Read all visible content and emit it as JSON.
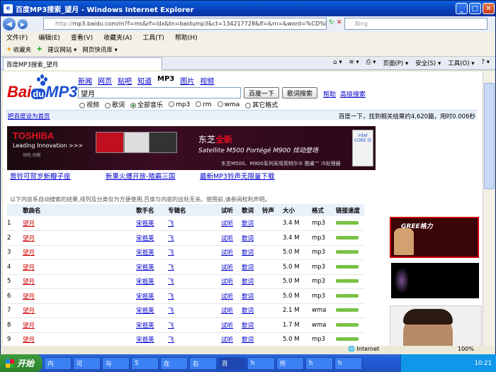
{
  "window": {
    "title": "百度MP3搜索_望月 - Windows Internet Explorer"
  },
  "address": {
    "url_prefix": "http://",
    "url": "mp3.baidu.com/m?f=ms&rf=idx&tn=baidump3&ct=134217728&lf=&rn=&word=%CD%FB%D4%C2&",
    "search_placeholder": "Bing"
  },
  "menu": [
    "文件(F)",
    "编辑(E)",
    "查看(V)",
    "收藏夹(A)",
    "工具(T)",
    "帮助(H)"
  ],
  "favbar": {
    "favorites": "收藏夹",
    "suggested": "建议网站 ▾",
    "slices": "网页快讯库 ▾"
  },
  "tab": {
    "label": "百度MP3搜索_望月"
  },
  "tools": {
    "page": "页面(P) ▾",
    "safety": "安全(S) ▾",
    "tools": "工具(O) ▾"
  },
  "baidu": {
    "logo_b": "Bai",
    "logo_du": "du",
    "logo_mp3": "MP3",
    "nav": [
      "新闻",
      "网页",
      "贴吧",
      "知道",
      "MP3",
      "图片",
      "视频"
    ],
    "query": "望月",
    "search_btn": "百度一下",
    "lyric_btn": "歌词搜索",
    "help": "帮助",
    "advanced": "高级搜索",
    "opts": [
      "视频",
      "歌词",
      "全部音乐",
      "mp3",
      "rm",
      "wma",
      "其它格式"
    ],
    "set_home": "把百度设为首页",
    "result_info": "百度一下，找到相关结果约4,620篇，用时0.006秒"
  },
  "banner": {
    "brand": "TOSHIBA",
    "tag": "Leading Innovation >>>",
    "sub": "领先·创新",
    "headline_a": "东芝",
    "headline_b": "全新",
    "model": "Satellite M500 Portégé M900 炫动登场",
    "foot": "东芝M500、M900系列采用英特尔® 酷睿™ i5处理器",
    "intel": "intel CORE i5"
  },
  "ads": [
    "普铃可贺岁新瓣子座",
    "新果火爆开放-殖霸三国",
    "最新MP3铃声无限量下载"
  ],
  "note": "以下内容系自动搜索的结果,排列及分类仅为方便使用,百度与内容的出处无关。使用前,请参阅权利声明。",
  "columns": [
    "",
    "歌曲名",
    "歌手名",
    "专辑名",
    "试听",
    "歌词",
    "铃声",
    "大小",
    "格式",
    "链接速度"
  ],
  "rows": [
    {
      "n": "1",
      "song": "望月",
      "singer": "宋祖英",
      "album": "飞",
      "listen": "试听",
      "lyric": "歌词",
      "size": "3.4 M",
      "fmt": "mp3"
    },
    {
      "n": "2",
      "song": "望月",
      "singer": "宋祖英",
      "album": "飞",
      "listen": "试听",
      "lyric": "歌词",
      "size": "3.4 M",
      "fmt": "mp3"
    },
    {
      "n": "3",
      "song": "望月",
      "singer": "宋祖英",
      "album": "飞",
      "listen": "试听",
      "lyric": "歌词",
      "size": "5.0 M",
      "fmt": "mp3"
    },
    {
      "n": "4",
      "song": "望月",
      "singer": "宋祖英",
      "album": "飞",
      "listen": "试听",
      "lyric": "歌词",
      "size": "5.0 M",
      "fmt": "mp3"
    },
    {
      "n": "5",
      "song": "望月",
      "singer": "宋祖英",
      "album": "飞",
      "listen": "试听",
      "lyric": "歌词",
      "size": "5.0 M",
      "fmt": "mp3"
    },
    {
      "n": "6",
      "song": "望月",
      "singer": "宋祖英",
      "album": "飞",
      "listen": "试听",
      "lyric": "歌词",
      "size": "5.0 M",
      "fmt": "mp3"
    },
    {
      "n": "7",
      "song": "望月",
      "singer": "宋祖英",
      "album": "飞",
      "listen": "试听",
      "lyric": "歌词",
      "size": "2.1 M",
      "fmt": "wma"
    },
    {
      "n": "8",
      "song": "望月",
      "singer": "宋祖英",
      "album": "飞",
      "listen": "试听",
      "lyric": "歌词",
      "size": "1.7 M",
      "fmt": "wma"
    },
    {
      "n": "9",
      "song": "望月",
      "singer": "宋祖英",
      "album": "飞",
      "listen": "试听",
      "lyric": "歌词",
      "size": "5.0 M",
      "fmt": "mp3"
    }
  ],
  "side": {
    "gree": "GREE格力"
  },
  "status": {
    "zone": "Internet",
    "zoom": "100%"
  },
  "taskbar": {
    "start": "开始",
    "items": [
      "内",
      "可",
      "与",
      "5",
      "在",
      "右",
      "百",
      "h",
      "所",
      "h",
      "h"
    ],
    "clock": "10:21"
  }
}
